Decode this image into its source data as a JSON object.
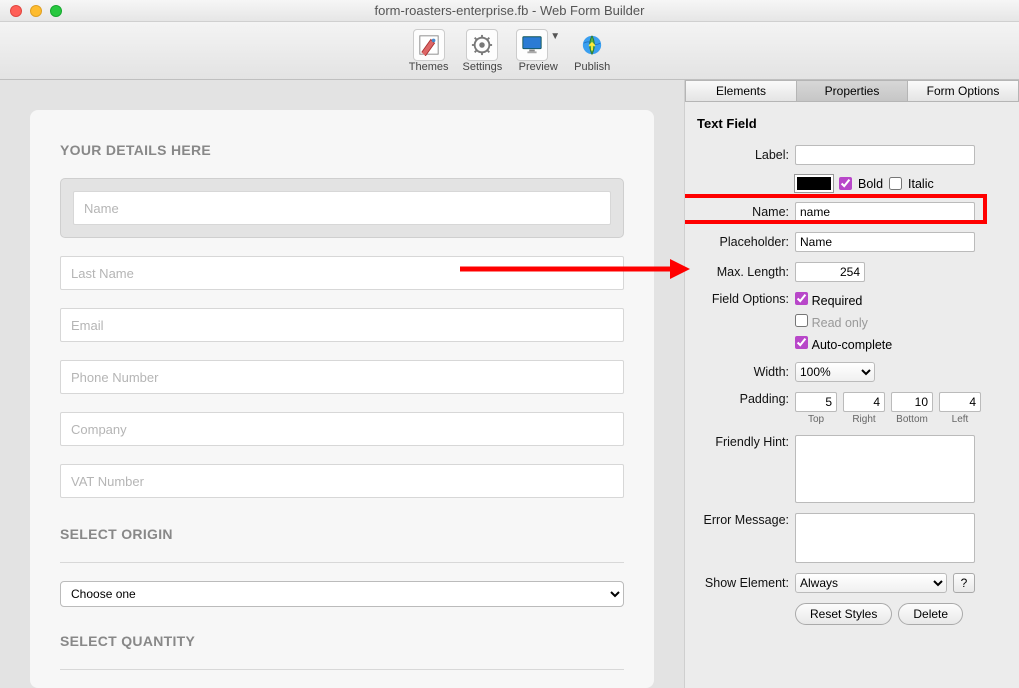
{
  "window": {
    "title": "form-roasters-enterprise.fb - Web Form Builder"
  },
  "toolbar": {
    "themes": "Themes",
    "settings": "Settings",
    "preview": "Preview",
    "publish": "Publish"
  },
  "form": {
    "section1_title": "YOUR DETAILS HERE",
    "fields": {
      "name": "Name",
      "lastname": "Last Name",
      "email": "Email",
      "phone": "Phone Number",
      "company": "Company",
      "vat": "VAT Number"
    },
    "section2_title": "SELECT ORIGIN",
    "choose": "Choose one",
    "section3_title": "SELECT QUANTITY"
  },
  "tabs": {
    "elements": "Elements",
    "properties": "Properties",
    "options": "Form Options"
  },
  "panel": {
    "title": "Text Field",
    "label_l": "Label:",
    "label_v": "",
    "bold": "Bold",
    "italic": "Italic",
    "bold_checked": true,
    "italic_checked": false,
    "name_l": "Name:",
    "name_v": "name",
    "placeholder_l": "Placeholder:",
    "placeholder_v": "Name",
    "maxlen_l": "Max. Length:",
    "maxlen_v": "254",
    "fieldopt_l": "Field Options:",
    "required": "Required",
    "required_checked": true,
    "readonly": "Read only",
    "readonly_checked": false,
    "autocomplete": "Auto-complete",
    "autocomplete_checked": true,
    "width_l": "Width:",
    "width_v": "100%",
    "padding_l": "Padding:",
    "pad_top": "5",
    "pad_right": "4",
    "pad_bottom": "10",
    "pad_left": "4",
    "pad_top_c": "Top",
    "pad_right_c": "Right",
    "pad_bottom_c": "Bottom",
    "pad_left_c": "Left",
    "hint_l": "Friendly Hint:",
    "hint_v": "",
    "error_l": "Error Message:",
    "error_v": "",
    "show_l": "Show Element:",
    "show_v": "Always",
    "help": "?",
    "reset": "Reset Styles",
    "delete": "Delete"
  }
}
